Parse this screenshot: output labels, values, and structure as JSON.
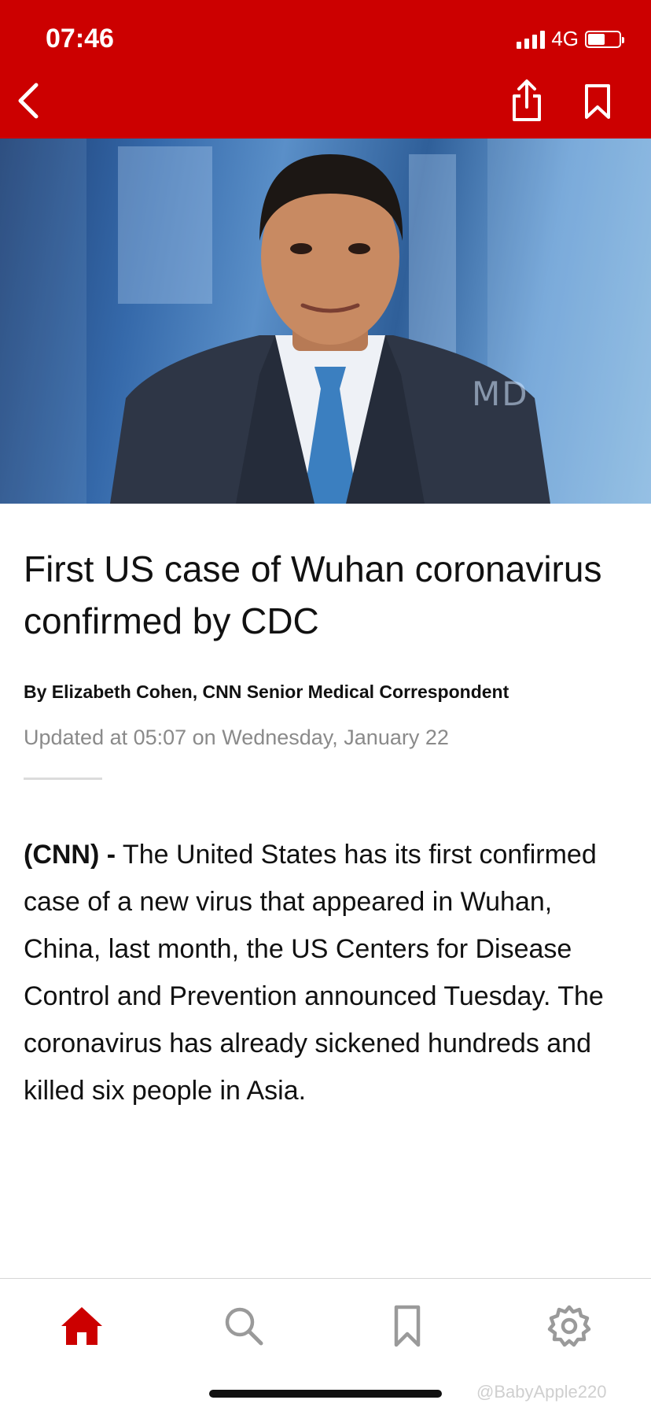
{
  "status_bar": {
    "time": "07:46",
    "network": "4G",
    "battery_level": 0.55
  },
  "toolbar": {
    "back_icon": "chevron-left-icon",
    "share_icon": "share-icon",
    "bookmark_icon": "bookmark-icon"
  },
  "hero": {
    "brand_overlay": "MD"
  },
  "article": {
    "title": "First US case of Wuhan coronavirus confirmed by CDC",
    "byline": "By Elizabeth Cohen, CNN Senior Medical Correspondent",
    "updated": "Updated at 05:07 on Wednesday, January 22",
    "source_tag": "(CNN) -",
    "body": "The United States has its first confirmed case of a new virus that appeared in Wuhan, China, last month, the US Centers for Disease Control and Prevention announced Tuesday. The coronavirus has already sickened hundreds and killed six people in Asia."
  },
  "tabbar": {
    "items": [
      {
        "name": "home",
        "icon": "home-icon",
        "active": true
      },
      {
        "name": "search",
        "icon": "search-icon",
        "active": false
      },
      {
        "name": "saved",
        "icon": "bookmark-icon",
        "active": false
      },
      {
        "name": "settings",
        "icon": "gear-icon",
        "active": false
      }
    ]
  },
  "watermark": "@BabyApple220",
  "colors": {
    "brand_red": "#cc0000",
    "inactive_icon": "#9a9a9a",
    "meta_gray": "#8a8a8a"
  }
}
